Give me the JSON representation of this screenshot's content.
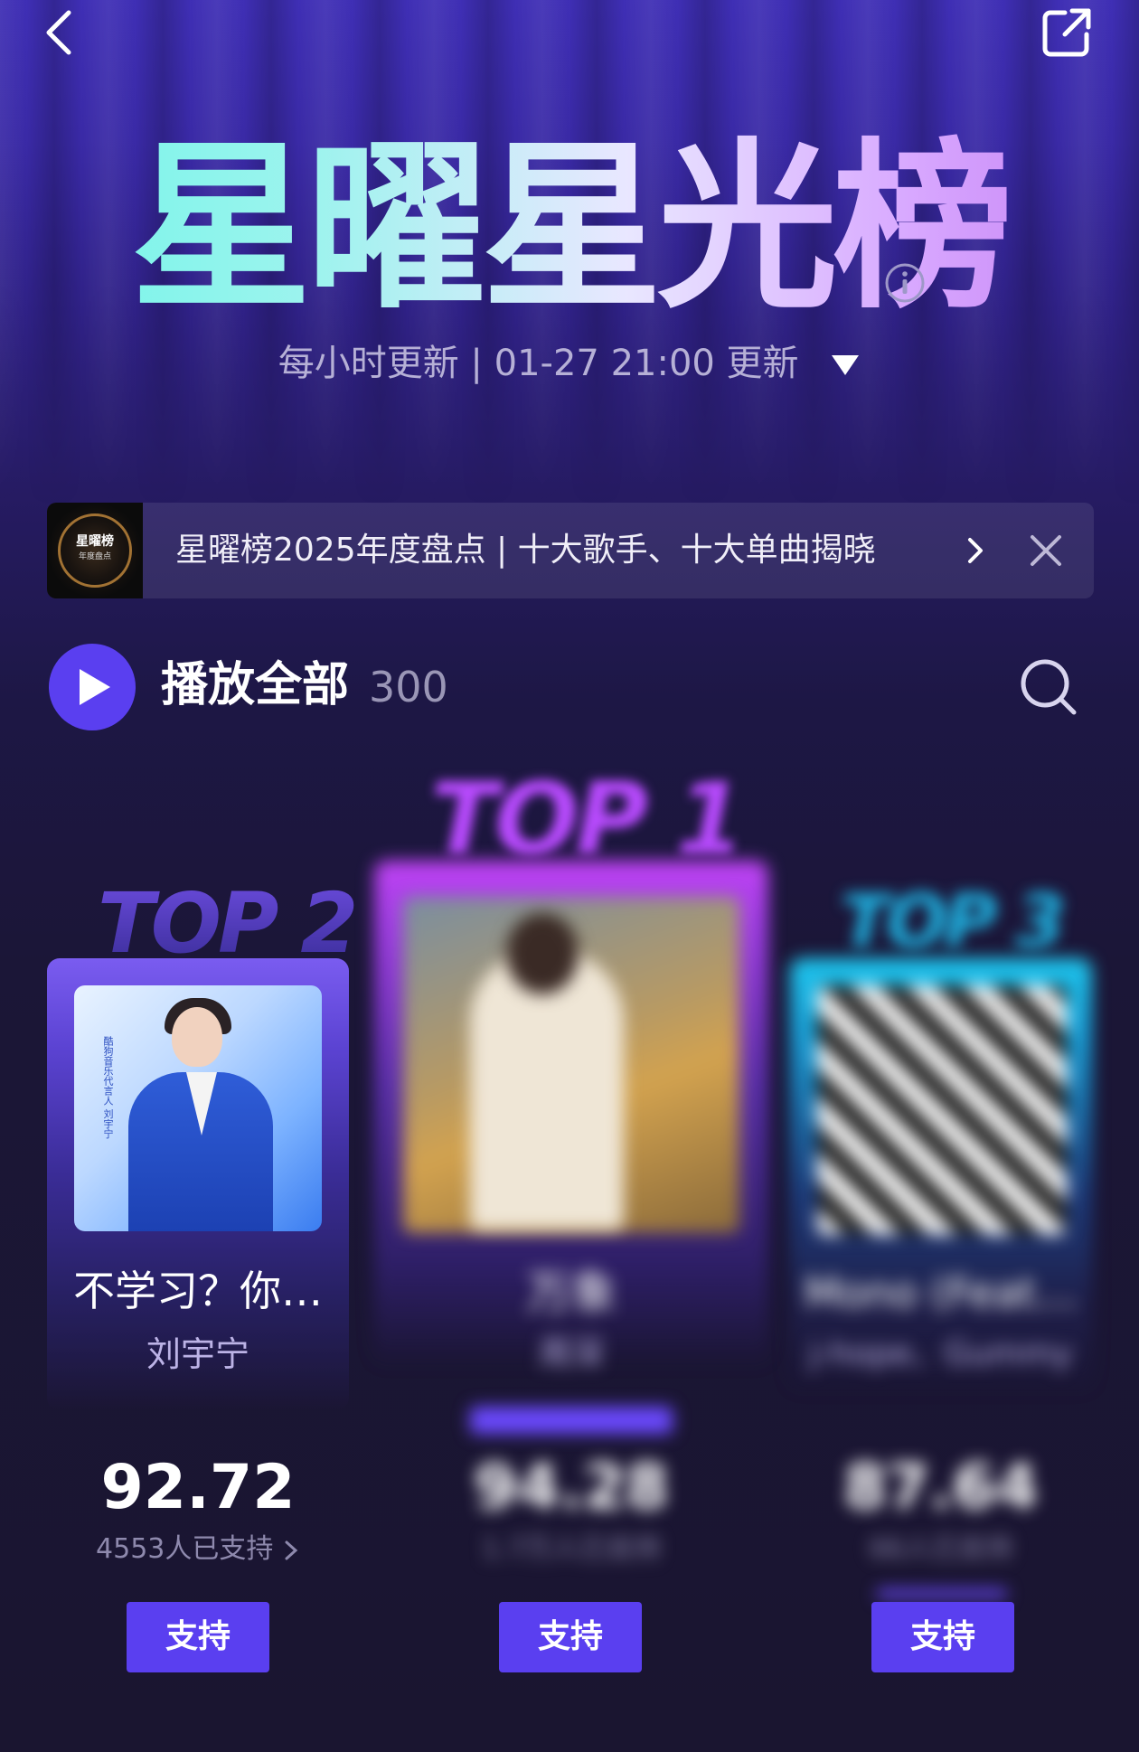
{
  "header": {
    "title": "星曜星光榜",
    "update_text": "每小时更新 | 01-27 21:00 更新"
  },
  "banner": {
    "thumb_title": "星曜榜",
    "thumb_subtitle": "年度盘点",
    "text": "星曜榜2025年度盘点 | 十大歌手、十大单曲揭晓"
  },
  "playlist": {
    "play_all_label": "播放全部",
    "count": "300"
  },
  "podium": {
    "top1": {
      "rank_label": "TOP 1",
      "song": "万象",
      "artist": "周深",
      "score": "94.28",
      "support_text": "1.7万人已支持",
      "button": "支持"
    },
    "top2": {
      "rank_label": "TOP 2",
      "song": "不学习？你…",
      "artist": "刘宇宁",
      "score": "92.72",
      "support_text": "4553人已支持",
      "button": "支持",
      "cover_text": "酷狗音乐代言人 刘宇宁"
    },
    "top3": {
      "rank_label": "TOP 3",
      "song": "Mono (Feat…",
      "artist": "j-hope、Gummy",
      "score": "87.64",
      "support_text": "66人已支持",
      "button": "支持"
    }
  },
  "colors": {
    "accent": "#5a3ff0",
    "top1": "#b94bff",
    "top2": "#6a4bdc",
    "top3": "#1fb7e6"
  }
}
